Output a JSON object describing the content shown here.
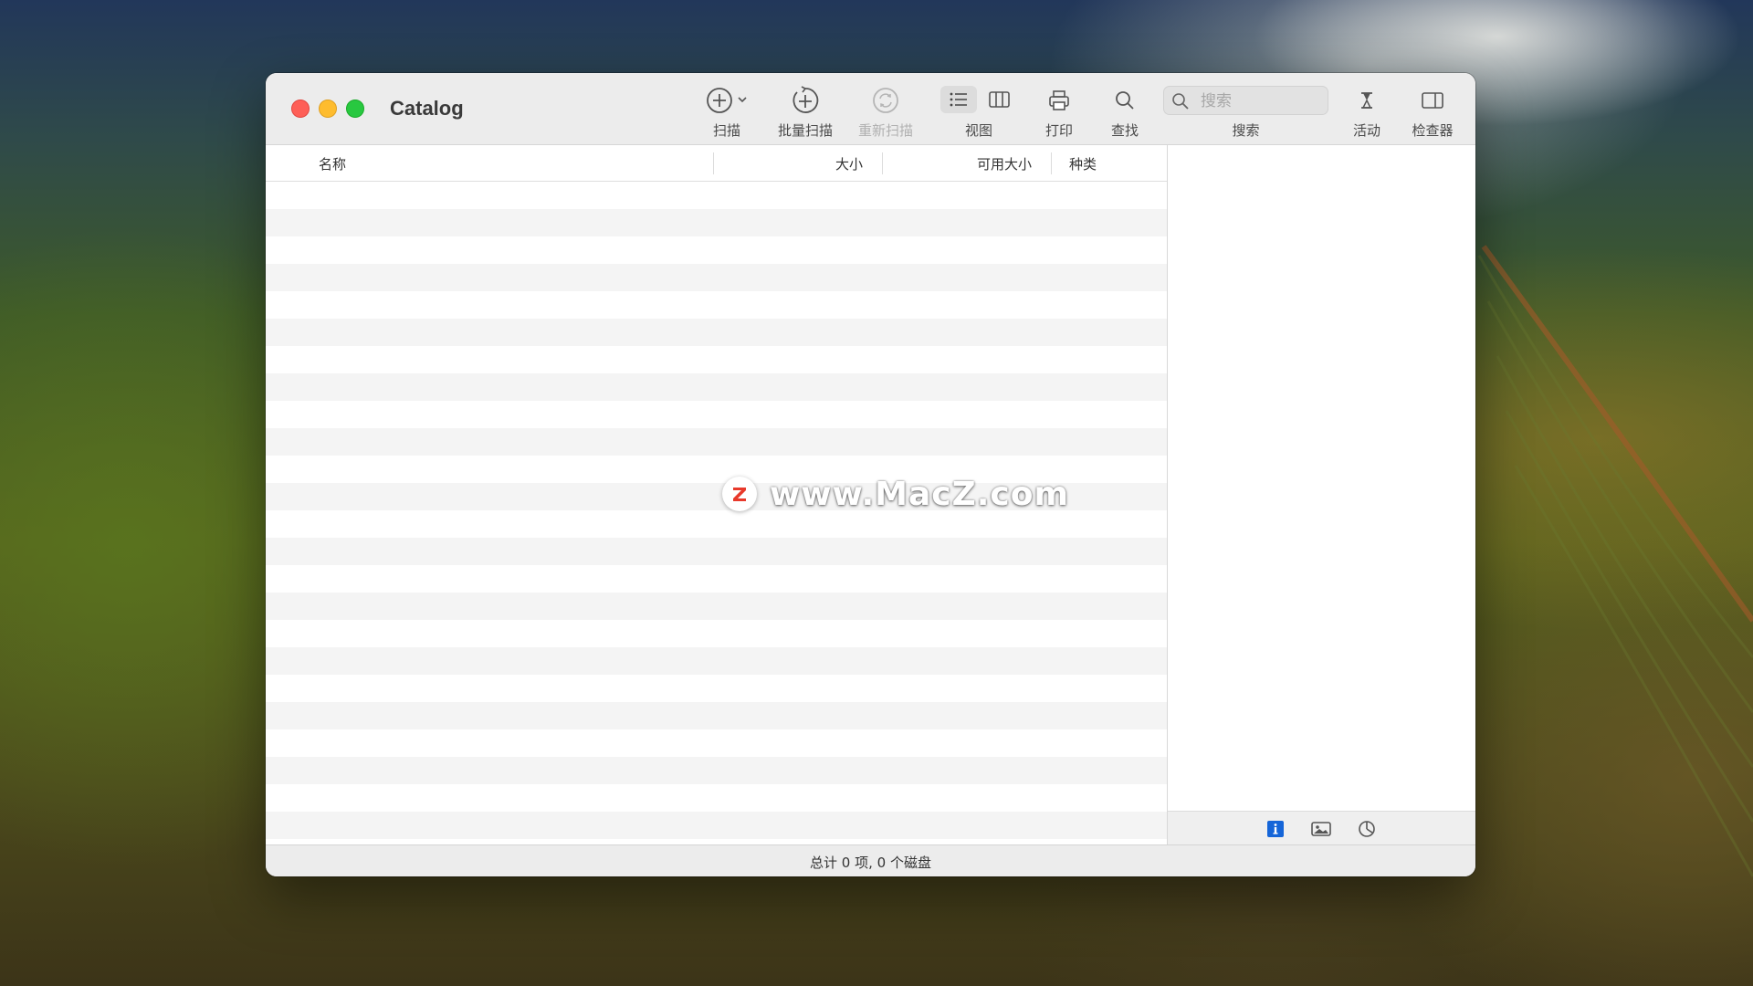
{
  "window": {
    "title": "Catalog"
  },
  "toolbar": {
    "scan_label": "扫描",
    "batch_scan_label": "批量扫描",
    "rescan_label": "重新扫描",
    "view_label": "视图",
    "print_label": "打印",
    "find_label": "查找",
    "search_label": "搜索",
    "search_placeholder": "搜索",
    "activity_label": "活动",
    "inspector_label": "检查器"
  },
  "table": {
    "columns": [
      "名称",
      "大小",
      "可用大小",
      "种类"
    ],
    "rows": []
  },
  "status": {
    "text": "总计 0 项, 0 个磁盘"
  },
  "watermark": {
    "badge": "Z",
    "text": "www.MacZ.com"
  },
  "colors": {
    "close": "#fe5f57",
    "minimize": "#febc2e",
    "maximize": "#28c840",
    "info_active": "#1565d8",
    "scroll_thumb": "#7e7e7e",
    "watermark_badge": "#e8392b"
  }
}
